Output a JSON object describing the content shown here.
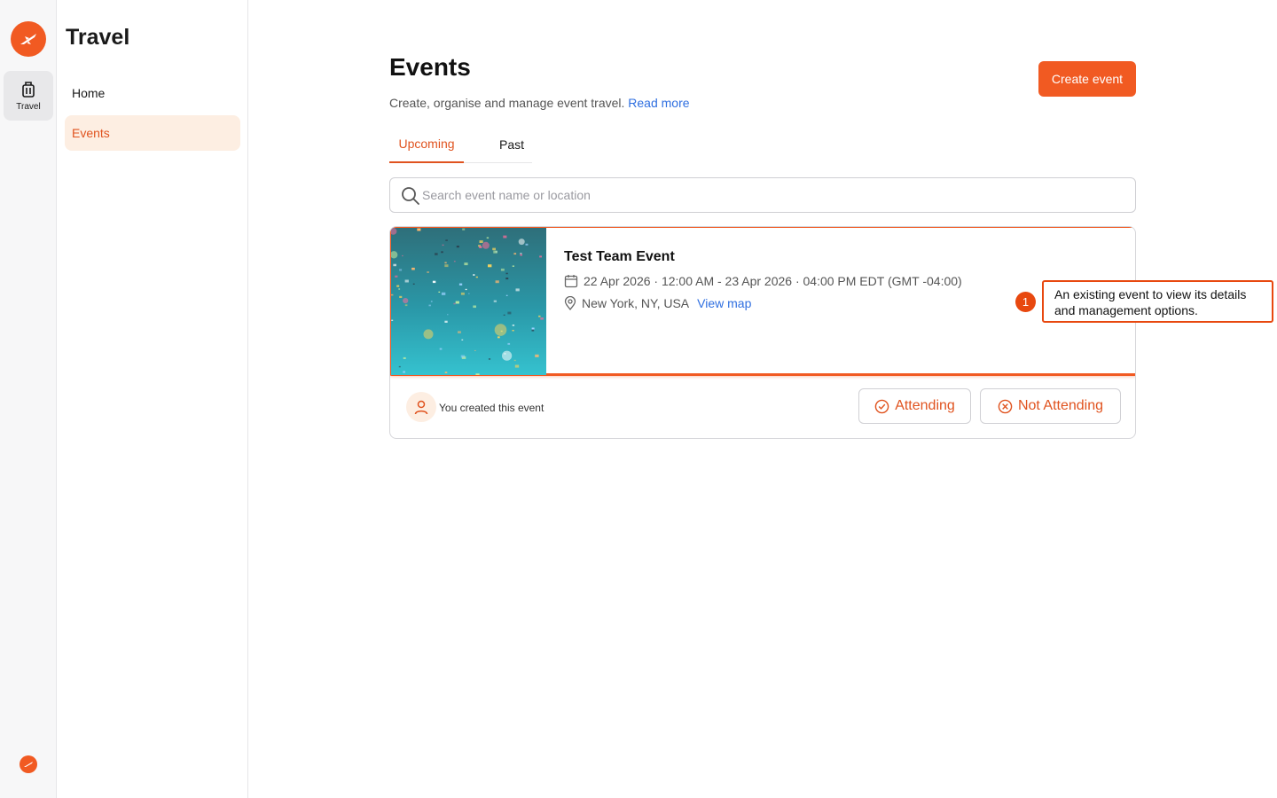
{
  "rail": {
    "travel_label": "Travel"
  },
  "sidebar": {
    "title": "Travel",
    "items": [
      {
        "label": "Home"
      },
      {
        "label": "Events"
      }
    ]
  },
  "header": {
    "title": "Events",
    "subtitle": "Create, organise and manage event travel.",
    "read_more": "Read more",
    "create_button": "Create event"
  },
  "tabs": [
    {
      "label": "Upcoming",
      "active": true
    },
    {
      "label": "Past",
      "active": false
    }
  ],
  "search": {
    "placeholder": "Search event name or location",
    "value": ""
  },
  "event": {
    "name": "Test Team Event",
    "date": "22 Apr 2026 · 12:00 AM - 23 Apr 2026 · 04:00 PM EDT (GMT -04:00)",
    "location": "New York, NY, USA",
    "view_map": "View map",
    "creator_text": "You created this event",
    "attending_label": "Attending",
    "not_attending_label": "Not Attending"
  },
  "annotation": {
    "number": "1",
    "text": "An existing event to view its details and management options."
  },
  "colors": {
    "brand": "#f15a22",
    "link": "#2f6fe0",
    "active_bg": "#fdeee2"
  }
}
